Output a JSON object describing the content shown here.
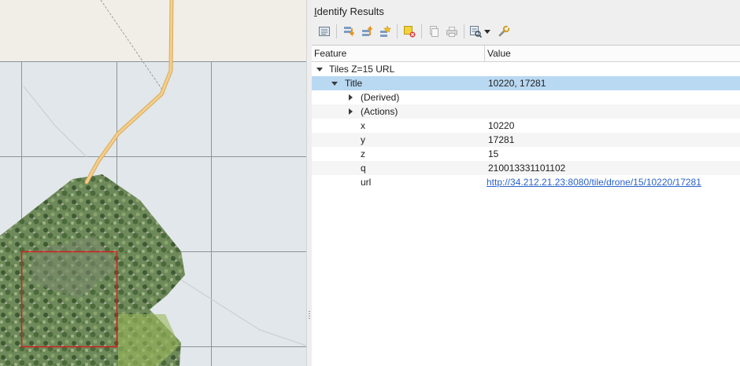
{
  "panel": {
    "title_underlined": "I",
    "title_rest": "dentify Results"
  },
  "toolbar": {
    "icons": [
      "expand-all-icon",
      "expand-new-icon",
      "collapse-all-icon",
      "expand-tree-icon",
      "clear-highlights-icon",
      "copy-feature-icon",
      "print-icon",
      "identify-mode-icon",
      "dropdown-arrow-icon",
      "settings-wrench-icon"
    ]
  },
  "table": {
    "col_feature": "Feature",
    "col_value": "Value"
  },
  "tree": {
    "layer": "Tiles Z=15 URL",
    "title_label": "Title",
    "title_value": "10220, 17281",
    "derived": "(Derived)",
    "actions": "(Actions)",
    "attributes": [
      {
        "name": "x",
        "value": "10220"
      },
      {
        "name": "y",
        "value": "17281"
      },
      {
        "name": "z",
        "value": "15"
      },
      {
        "name": "q",
        "value": "210013331101102"
      },
      {
        "name": "url",
        "value": "http://34.212.21.23:8080/tile/drone/15/10220/17281"
      }
    ]
  },
  "colors": {
    "selection": "#b9d8f2",
    "link": "#2a62c9",
    "tile_outline": "#d02020",
    "road": "#f0c070"
  }
}
